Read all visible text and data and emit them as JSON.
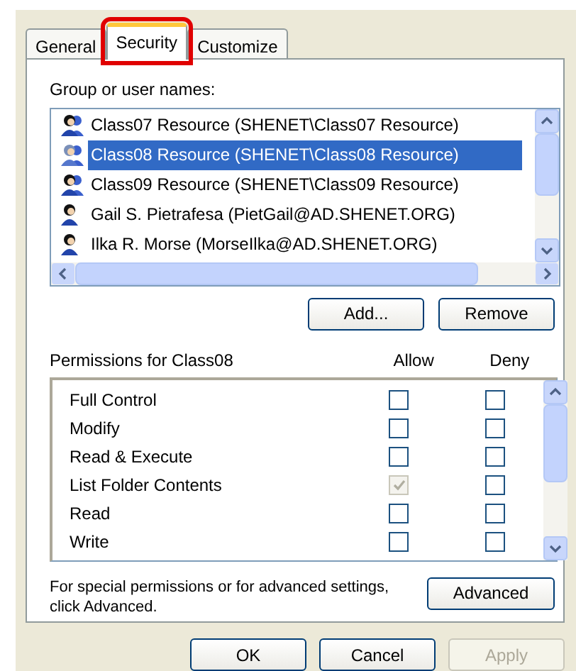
{
  "tabs": [
    {
      "label": "General",
      "selected": false,
      "highlighted": false
    },
    {
      "label": "Security",
      "selected": true,
      "highlighted": true
    },
    {
      "label": "Customize",
      "selected": false,
      "highlighted": false
    }
  ],
  "users_label": "Group or user names:",
  "users": [
    {
      "name": "Class07 Resource (SHENET\\Class07 Resource)",
      "kind": "group",
      "selected": false
    },
    {
      "name": "Class08 Resource (SHENET\\Class08 Resource)",
      "kind": "group",
      "selected": true
    },
    {
      "name": "Class09 Resource (SHENET\\Class09 Resource)",
      "kind": "group",
      "selected": false
    },
    {
      "name": "Gail S. Pietrafesa (PietGail@AD.SHENET.ORG)",
      "kind": "user",
      "selected": false
    },
    {
      "name": "Ilka R. Morse (MorseIlka@AD.SHENET.ORG)",
      "kind": "user",
      "selected": false
    }
  ],
  "user_buttons": [
    "Add...",
    "Remove"
  ],
  "permissions_label": "Permissions for Class08",
  "columns": [
    "Allow",
    "Deny"
  ],
  "permissions": [
    {
      "name": "Full Control",
      "allow": {
        "checked": false,
        "disabled": false
      },
      "deny": {
        "checked": false,
        "disabled": false
      }
    },
    {
      "name": "Modify",
      "allow": {
        "checked": false,
        "disabled": false
      },
      "deny": {
        "checked": false,
        "disabled": false
      }
    },
    {
      "name": "Read & Execute",
      "allow": {
        "checked": false,
        "disabled": false
      },
      "deny": {
        "checked": false,
        "disabled": false
      }
    },
    {
      "name": "List Folder Contents",
      "allow": {
        "checked": true,
        "disabled": true
      },
      "deny": {
        "checked": false,
        "disabled": false
      }
    },
    {
      "name": "Read",
      "allow": {
        "checked": false,
        "disabled": false
      },
      "deny": {
        "checked": false,
        "disabled": false
      }
    },
    {
      "name": "Write",
      "allow": {
        "checked": false,
        "disabled": false
      },
      "deny": {
        "checked": false,
        "disabled": false
      }
    }
  ],
  "advanced_text": "For special permissions or for advanced settings, click Advanced.",
  "advanced_button": "Advanced",
  "dialog_buttons": [
    {
      "label": "OK",
      "disabled": false
    },
    {
      "label": "Cancel",
      "disabled": false
    },
    {
      "label": "Apply",
      "disabled": true
    }
  ]
}
